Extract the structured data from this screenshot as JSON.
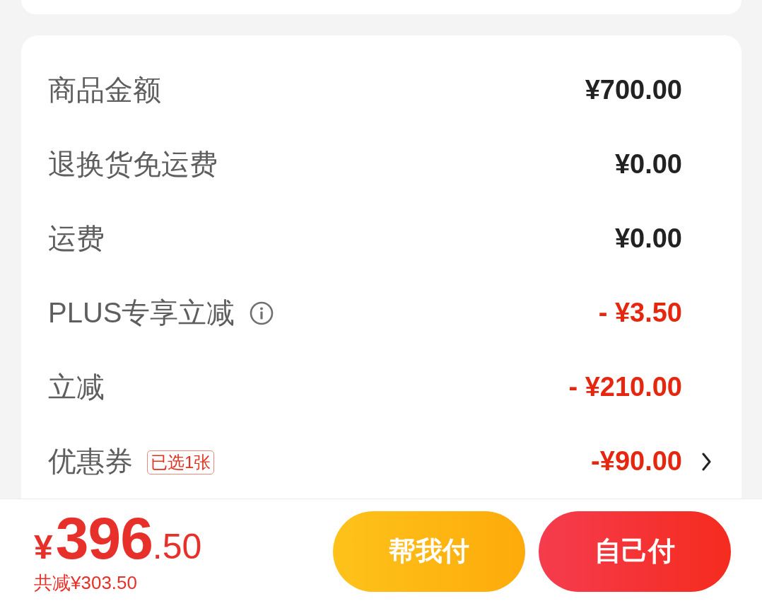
{
  "price_rows": [
    {
      "label": "商品金额",
      "value": "¥700.00",
      "discount": false
    },
    {
      "label": "退换货免运费",
      "value": "¥0.00",
      "discount": false
    },
    {
      "label": "运费",
      "value": "¥0.00",
      "discount": false
    },
    {
      "label": "PLUS专享立减",
      "value": "- ¥3.50",
      "discount": true,
      "info": true
    },
    {
      "label": "立减",
      "value": "- ¥210.00",
      "discount": true
    },
    {
      "label": "优惠券",
      "tag": "已选1张",
      "value": "-¥90.00",
      "discount": true,
      "expandable": true
    }
  ],
  "footer": {
    "total": {
      "currency": "¥",
      "integer": "396",
      "decimal": ".50"
    },
    "saved": "共减¥303.50",
    "buttons": [
      {
        "label": "帮我付",
        "kind": "friend_pay"
      },
      {
        "label": "自己付",
        "kind": "self_pay"
      }
    ]
  }
}
